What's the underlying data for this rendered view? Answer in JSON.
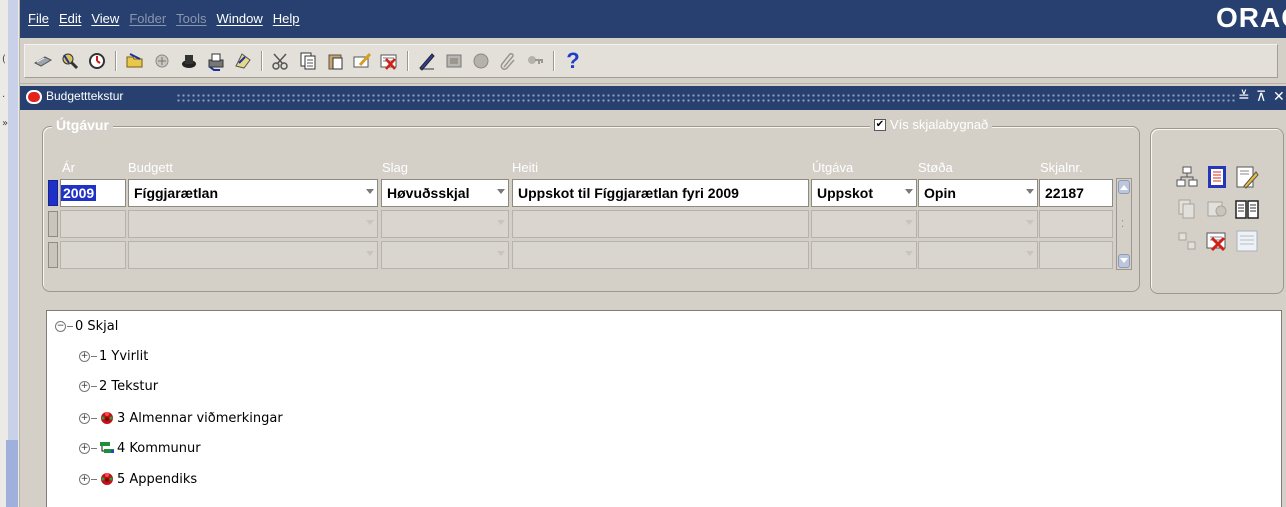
{
  "menubar": {
    "items": [
      {
        "label": "File",
        "enabled": true
      },
      {
        "label": "Edit",
        "enabled": true
      },
      {
        "label": "View",
        "enabled": true
      },
      {
        "label": "Folder",
        "enabled": false
      },
      {
        "label": "Tools",
        "enabled": false
      },
      {
        "label": "Window",
        "enabled": true
      },
      {
        "label": "Help",
        "enabled": true
      }
    ],
    "brand": "ORACLE"
  },
  "toolbar": {
    "help_glyph": "?",
    "icons": [
      "new-icon",
      "find-icon",
      "clock-icon",
      "open-folder-icon",
      "navigate-icon",
      "zoom-icon",
      "print-icon",
      "attachments-icon",
      "cut-icon",
      "copy-icon",
      "paste-icon",
      "clear-field-icon",
      "delete-record-icon",
      "edit-field-icon",
      "folder-icon",
      "translation-icon",
      "attachment-icon",
      "flexfield-icon",
      "help-icon"
    ]
  },
  "window": {
    "title": "Budgetttekstur"
  },
  "form": {
    "section_title": "Útgávur",
    "vis_label": "Vís skjalabygnað",
    "vis_checked": true,
    "columns": {
      "ar": "Ár",
      "budgett": "Budgett",
      "slag": "Slag",
      "heiti": "Heiti",
      "utgava": "Útgáva",
      "stoda": "Støða",
      "skjalnr": "Skjalnr."
    },
    "rows": [
      {
        "ar": "2009",
        "budgett": "Fíggjarætlan",
        "slag": "Høvuðsskjal",
        "heiti": "Uppskot til Fíggjarætlan fyri 2009",
        "utgava": "Uppskot",
        "stoda": "Opin",
        "skjalnr": "22187"
      },
      {
        "ar": "",
        "budgett": "",
        "slag": "",
        "heiti": "",
        "utgava": "",
        "stoda": "",
        "skjalnr": ""
      },
      {
        "ar": "",
        "budgett": "",
        "slag": "",
        "heiti": "",
        "utgava": "",
        "stoda": "",
        "skjalnr": ""
      }
    ]
  },
  "tree": {
    "root": {
      "label": "0 Skjal",
      "expanded": true
    },
    "children": [
      {
        "label": "1 Yvirlit",
        "icon": ""
      },
      {
        "label": "2 Tekstur",
        "icon": ""
      },
      {
        "label": "3 Almennar viðmerkingar",
        "icon": "traffic-light-icon"
      },
      {
        "label": "4 Kommunur",
        "icon": "org-chart-icon"
      },
      {
        "label": "5 Appendiks",
        "icon": "traffic-light-icon"
      }
    ]
  },
  "colors": {
    "titlebar": "#27406f",
    "form_bg": "#d4d0c8",
    "selection": "#2031c7",
    "close_red": "#e2231a"
  }
}
